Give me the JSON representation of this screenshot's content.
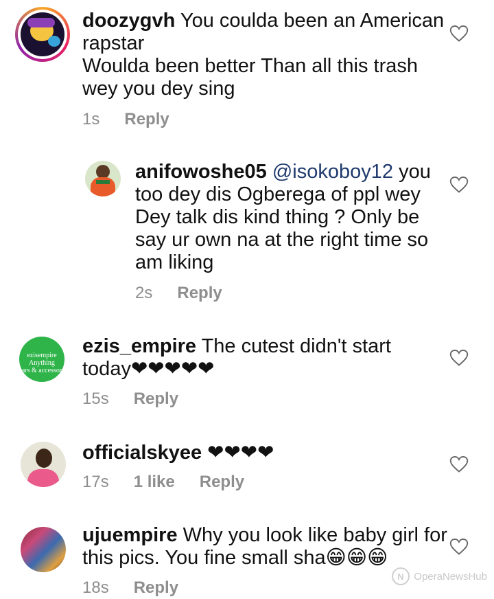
{
  "comments": [
    {
      "username": "doozygvh",
      "lines": [
        "You coulda been an American",
        "rapstar",
        "Woulda been better Than all this trash",
        "wey you dey sing"
      ],
      "time": "1s",
      "reply": "Reply"
    },
    {
      "username": "anifowoshe05",
      "mention": "@isokoboy12",
      "lines": [
        "you",
        "too dey dis Ogberega of ppl wey",
        "Dey talk dis kind thing ? Only be",
        "say ur own na at the right time so",
        "am liking"
      ],
      "time": "2s",
      "reply": "Reply"
    },
    {
      "username": "ezis_empire",
      "lines": [
        "The cutest didn't start",
        "today❤❤❤❤❤"
      ],
      "avatar_text": [
        "ezisempire",
        "Anything",
        "ars & accessor"
      ],
      "time": "15s",
      "reply": "Reply"
    },
    {
      "username": "officialskyee",
      "lines": [
        "❤❤❤❤"
      ],
      "time": "17s",
      "likes": "1 like",
      "reply": "Reply"
    },
    {
      "username": "ujuempire",
      "lines": [
        "Why you look like baby girl for",
        "this pics.  You fine small sha😁😁😁"
      ],
      "time": "18s",
      "reply": "Reply"
    }
  ],
  "watermark": "OperaNewsHub",
  "colors": {
    "meta": "#8e8e8e",
    "mention": "#1e3a6e",
    "ezis_green": "#2fb44a"
  }
}
